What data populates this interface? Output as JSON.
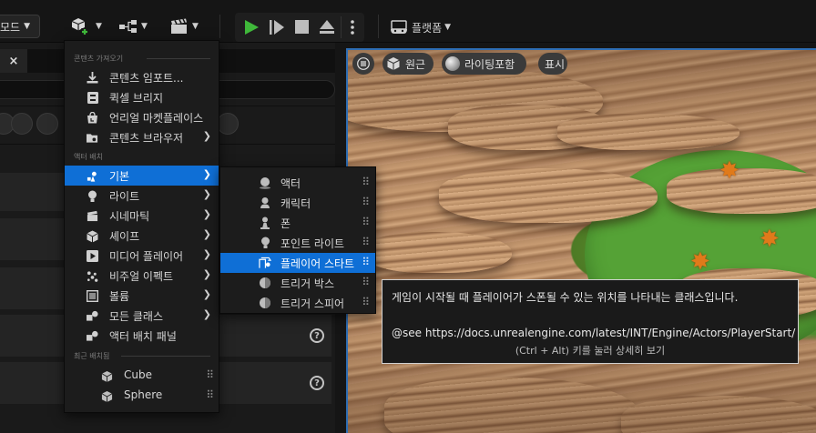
{
  "toolbar": {
    "mode_label": "모드",
    "platform_label": "플랫폼"
  },
  "left_panel": {
    "close_glyph": "×",
    "help_glyph": "?"
  },
  "viewport": {
    "perspective_label": "원근",
    "lighting_label": "라이팅포함",
    "show_label": "표시"
  },
  "menu": {
    "section_content": "콘텐츠 가져오기",
    "content_items": [
      {
        "label": "콘텐츠 임포트...",
        "icon": "import-icon"
      },
      {
        "label": "퀵셀 브리지",
        "icon": "bridge-icon"
      },
      {
        "label": "언리얼 마켓플레이스",
        "icon": "marketplace-icon"
      },
      {
        "label": "콘텐츠 브라우저",
        "icon": "content-browser-icon"
      }
    ],
    "section_place": "액터 배치",
    "place_items": [
      {
        "label": "기본",
        "icon": "basic-icon",
        "active": true
      },
      {
        "label": "라이트",
        "icon": "light-icon"
      },
      {
        "label": "시네마틱",
        "icon": "cinematic-icon"
      },
      {
        "label": "셰이프",
        "icon": "shape-icon"
      },
      {
        "label": "미디어 플레이어",
        "icon": "media-player-icon"
      },
      {
        "label": "비주얼 이펙트",
        "icon": "visual-effects-icon"
      },
      {
        "label": "볼륨",
        "icon": "volume-icon"
      },
      {
        "label": "모든 클래스",
        "icon": "all-classes-icon"
      },
      {
        "label": "액터 배치 패널",
        "icon": "place-actors-panel-icon"
      }
    ],
    "section_recent": "최근 배치됨",
    "recent_items": [
      {
        "label": "Cube",
        "icon": "cube-icon"
      },
      {
        "label": "Sphere",
        "icon": "sphere-icon"
      }
    ],
    "arrow_glyph": "❯",
    "grip_glyph": "⠿"
  },
  "submenu": {
    "items": [
      {
        "label": "액터",
        "icon": "actor-icon"
      },
      {
        "label": "캐릭터",
        "icon": "character-icon"
      },
      {
        "label": "폰",
        "icon": "pawn-icon"
      },
      {
        "label": "포인트 라이트",
        "icon": "point-light-icon"
      },
      {
        "label": "플레이어 스타트",
        "icon": "player-start-icon",
        "active": true
      },
      {
        "label": "트리거 박스",
        "icon": "trigger-box-icon"
      },
      {
        "label": "트리거 스피어",
        "icon": "trigger-sphere-icon"
      }
    ]
  },
  "tooltip": {
    "description": "게임이 시작될 때 플레이어가 스폰될 수 있는 위치를 나타내는 클래스입니다.",
    "see_link": "@see https://docs.unrealengine.com/latest/INT/Engine/Actors/PlayerStart/",
    "hint": "(Ctrl + Alt) 키를 눌러 상세히 보기"
  },
  "colors": {
    "accent": "#0f6fd6",
    "play_green": "#3fb83a",
    "viewport_border": "#2e6db3"
  }
}
